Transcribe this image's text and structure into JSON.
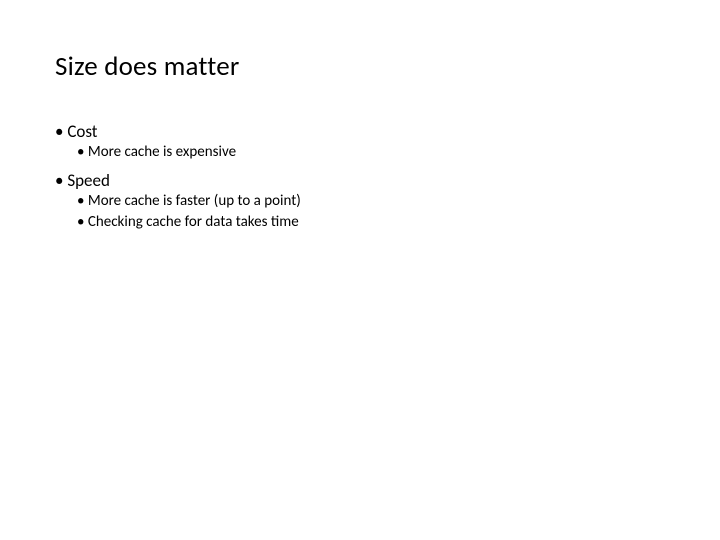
{
  "title": "Size does matter",
  "bullets": [
    {
      "label": "Cost",
      "subitems": [
        "More cache is expensive"
      ]
    },
    {
      "label": "Speed",
      "subitems": [
        "More cache is faster (up to a point)",
        "Checking cache for data takes time"
      ]
    }
  ]
}
